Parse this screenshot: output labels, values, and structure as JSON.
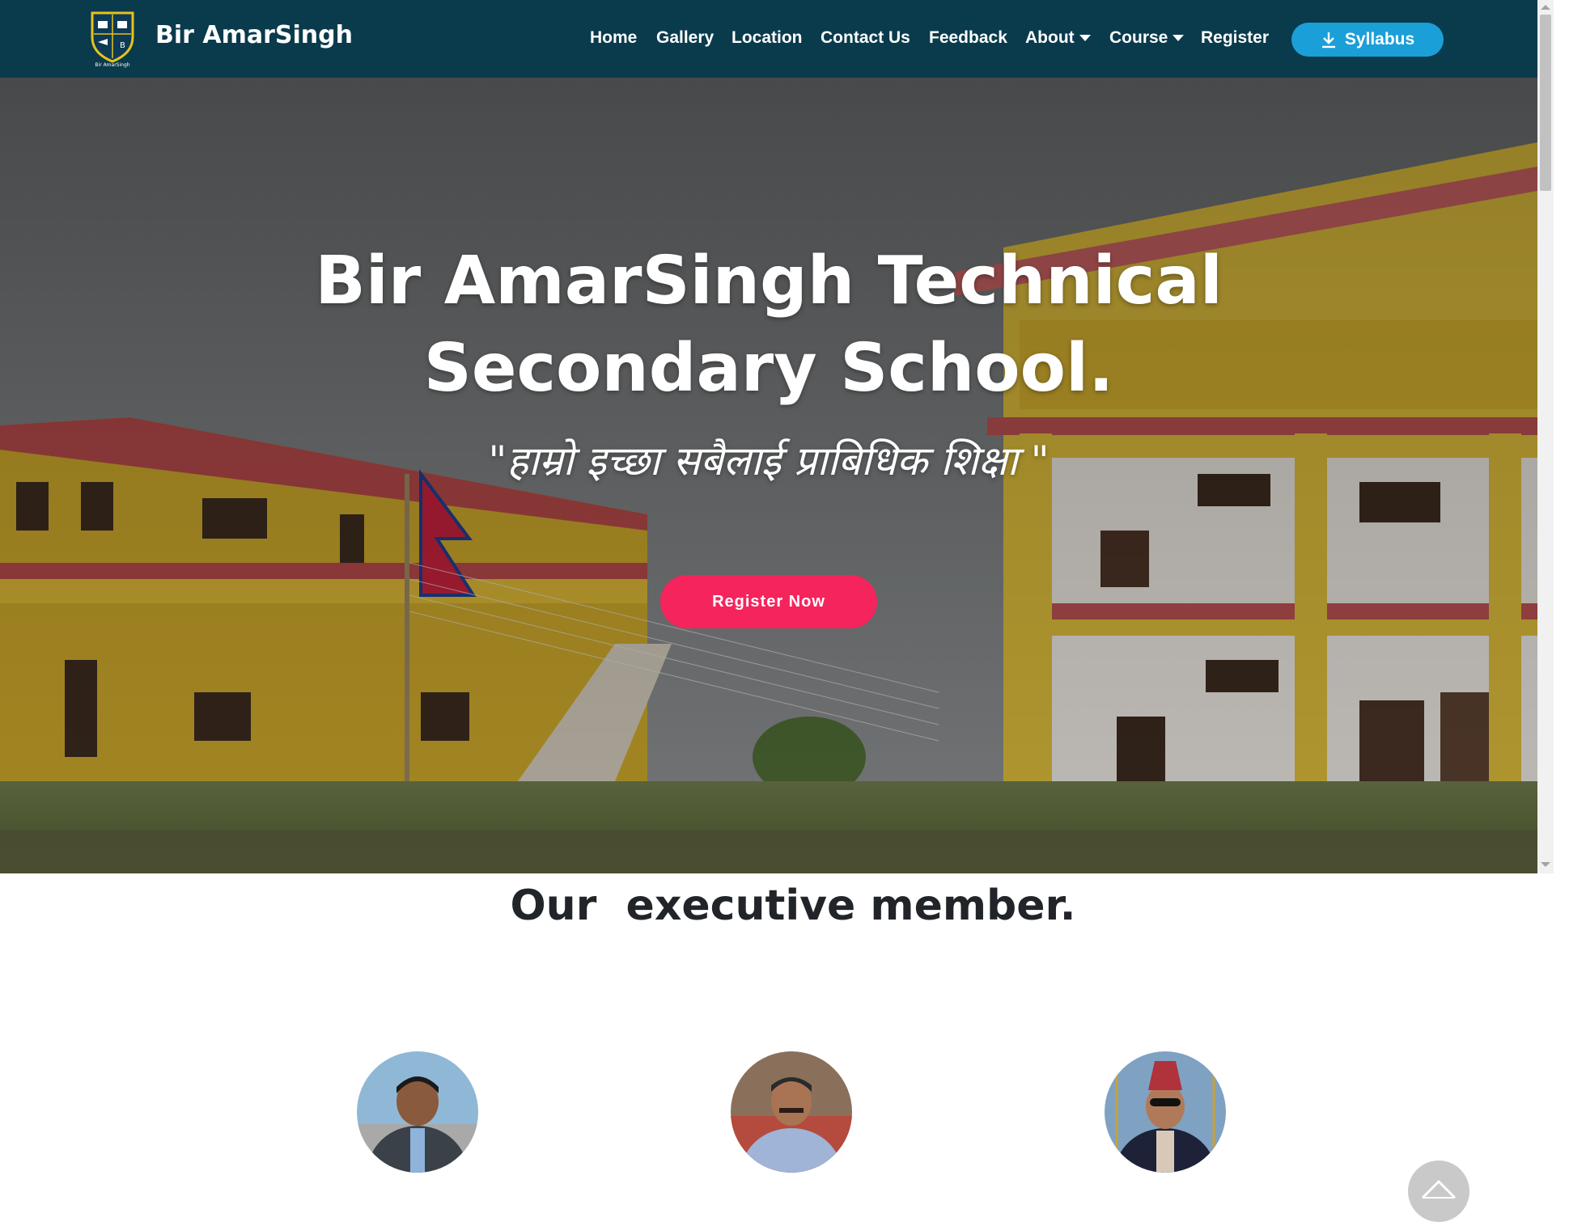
{
  "brand": {
    "name": "Bir AmarSingh",
    "logo_caption": "Bir AmarSingh",
    "logo_icon": "school-shield-logo"
  },
  "nav": {
    "home": "Home",
    "gallery": "Gallery",
    "location": "Location",
    "contact": "Contact Us",
    "feedback": "Feedback",
    "about": "About",
    "course": "Course",
    "register": "Register",
    "syllabus": "Syllabus",
    "syllabus_icon": "download-icon"
  },
  "hero": {
    "title_line1": "Bir AmarSingh Technical",
    "title_line2": "Secondary School.",
    "quote": "\"हाम्रो इच्छा सबैलाई प्राबिधिक शिक्षा \"",
    "cta": "Register Now"
  },
  "members": {
    "title": "Our  executive member."
  },
  "colors": {
    "navbar": "#093b4c",
    "syllabus_button": "#1b9fd8",
    "cta_button": "#f5245d",
    "heading_text": "#212529"
  }
}
